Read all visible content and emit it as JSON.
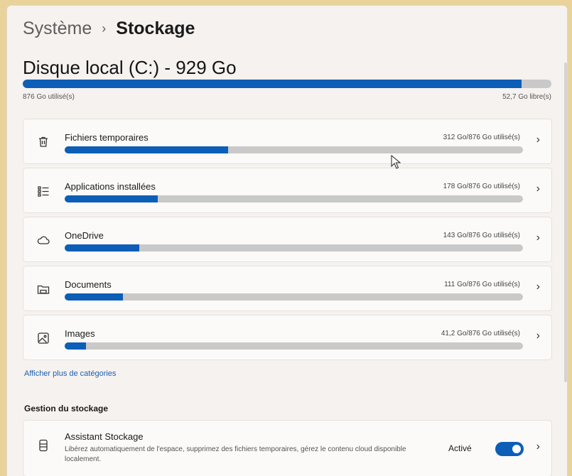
{
  "breadcrumb": {
    "parent": "Système",
    "separator": "›",
    "current": "Stockage"
  },
  "disk": {
    "title": "Disque local (C:) - 929 Go",
    "used_label": "876 Go utilisé(s)",
    "free_label": "52,7 Go libre(s)",
    "used_fraction": 0.943
  },
  "categories": [
    {
      "name": "Fichiers temporaires",
      "usage": "312 Go/876 Go utilisé(s)",
      "fraction": 0.356,
      "icon": "trash-icon"
    },
    {
      "name": "Applications installées",
      "usage": "178 Go/876 Go utilisé(s)",
      "fraction": 0.203,
      "icon": "apps-list-icon"
    },
    {
      "name": "OneDrive",
      "usage": "143 Go/876 Go utilisé(s)",
      "fraction": 0.163,
      "icon": "cloud-icon"
    },
    {
      "name": "Documents",
      "usage": "111 Go/876 Go utilisé(s)",
      "fraction": 0.127,
      "icon": "folder-icon"
    },
    {
      "name": "Images",
      "usage": "41,2 Go/876 Go utilisé(s)",
      "fraction": 0.047,
      "icon": "image-icon"
    }
  ],
  "more_link": "Afficher plus de catégories",
  "storage_management": {
    "section_title": "Gestion du stockage",
    "assistant": {
      "title": "Assistant Stockage",
      "description": "Libérez automatiquement de l'espace, supprimez des fichiers temporaires, gérez le contenu cloud disponible localement.",
      "state": "Activé",
      "enabled": true
    }
  },
  "colors": {
    "accent": "#0d5eb6",
    "track": "#c9c9c9",
    "link": "#1a5fb0"
  }
}
